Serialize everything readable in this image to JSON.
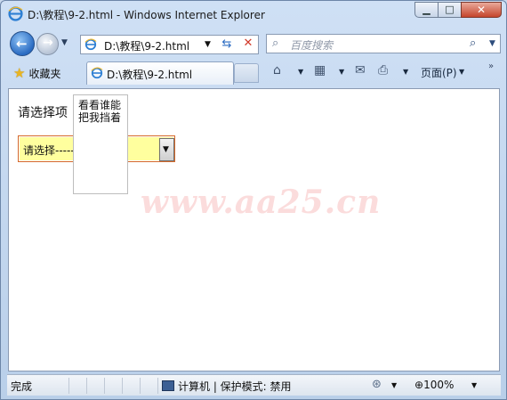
{
  "window": {
    "title": "D:\\教程\\9-2.html - Windows Internet Explorer",
    "min_glyph": "▁",
    "max_glyph": "□",
    "close_glyph": "✕"
  },
  "nav": {
    "back_glyph": "←",
    "forward_glyph": "→",
    "address_value": "D:\\教程\\9-2.html",
    "search_placeholder": "百度搜索"
  },
  "favbar": {
    "favorites_label": "收藏夹",
    "tab_title": "D:\\教程\\9-2.html",
    "page_menu_label": "页面(P)"
  },
  "page": {
    "prompt_label": "请选择项",
    "select_value": "请选择-------------",
    "overlay_text": "看看谁能把我挡着",
    "watermark": "www.aa25.cn"
  },
  "status": {
    "text": "完成",
    "zone": "计算机 | 保护模式: 禁用",
    "zoom": "100%"
  },
  "icons": {
    "home": "home-icon",
    "feeds": "feeds-icon",
    "mail": "mail-icon",
    "print": "print-icon"
  }
}
